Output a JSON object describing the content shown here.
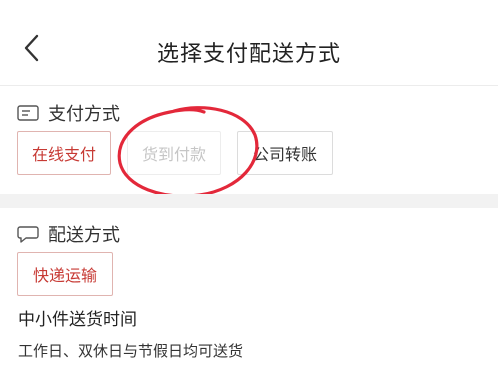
{
  "header": {
    "title": "选择支付配送方式",
    "back_icon": "chevron-left-icon"
  },
  "payment": {
    "label": "支付方式",
    "icon": "card-icon",
    "options": [
      {
        "label": "在线支付",
        "state": "selected"
      },
      {
        "label": "货到付款",
        "state": "disabled"
      },
      {
        "label": "公司转账",
        "state": "normal"
      }
    ]
  },
  "shipping": {
    "label": "配送方式",
    "icon": "chat-bubble-icon",
    "options": [
      {
        "label": "快递运输",
        "state": "selected"
      }
    ],
    "time_title": "中小件送货时间",
    "time_desc": "工作日、双休日与节假日均可送货"
  },
  "colors": {
    "accent": "#c73a34",
    "annotation": "#e3283a",
    "separator": "#f2f2f2"
  }
}
